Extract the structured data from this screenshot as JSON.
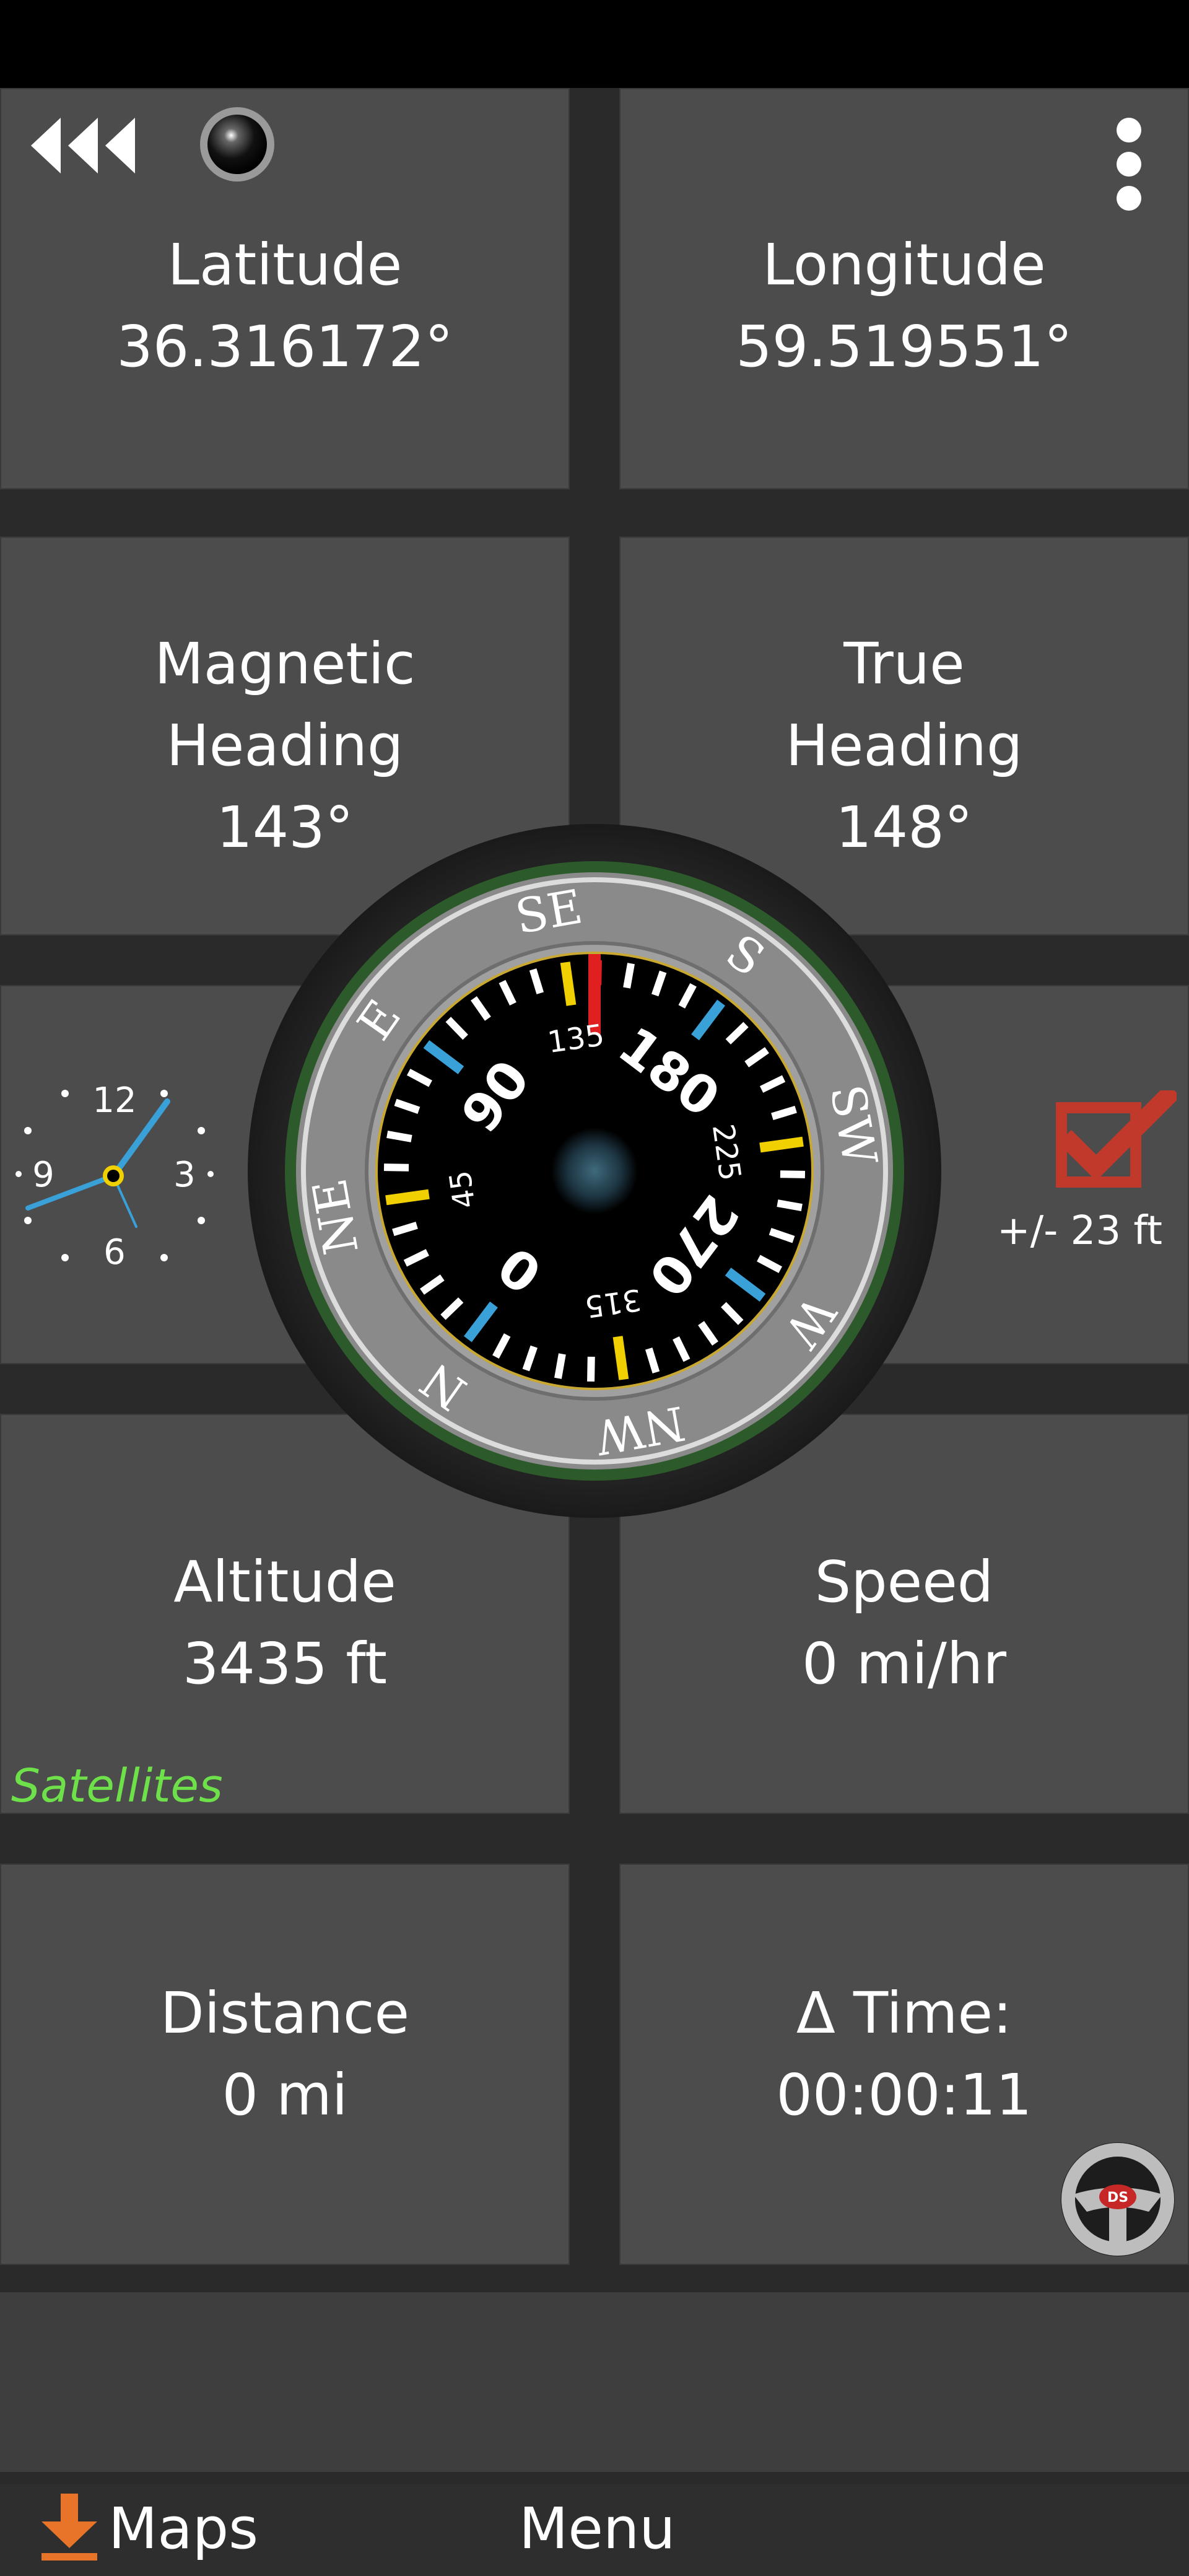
{
  "tiles": {
    "latitude": {
      "label": "Latitude",
      "value": "36.316172°"
    },
    "longitude": {
      "label": "Longitude",
      "value": "59.519551°"
    },
    "magnetic_heading": {
      "label1": "Magnetic",
      "label2": "Heading",
      "value": "143°"
    },
    "true_heading": {
      "label1": "True",
      "label2": "Heading",
      "value": "148°"
    },
    "altitude": {
      "label": "Altitude",
      "value": "3435 ft"
    },
    "speed": {
      "label": "Speed",
      "value": "0 mi/hr"
    },
    "distance": {
      "label": "Distance",
      "value": "0 mi"
    },
    "delta_time": {
      "label": "Δ Time:",
      "value": "00:00:11"
    }
  },
  "status": {
    "satellites": "Satellites",
    "accuracy": "+/- 23 ft"
  },
  "compass": {
    "heading_deg": 143,
    "ring_labels": [
      "SE",
      "S",
      "SW",
      "W",
      "NW",
      "N",
      "NE",
      "E"
    ],
    "dial_labels": [
      "135",
      "180",
      "225",
      "270",
      "315",
      "0",
      "45",
      "90"
    ],
    "colors": {
      "blue": "#3aa0d8",
      "yellow": "#f0d000",
      "red": "#e02020",
      "green_rim": "#2d5a2a"
    }
  },
  "clock": {
    "labels": [
      "12",
      "3",
      "6",
      "9"
    ]
  },
  "bottom": {
    "maps_label": "Maps",
    "menu_label": "Menu"
  },
  "icons": {
    "back": "triple-chevron-left-icon",
    "record": "record-ball-icon",
    "more": "vertical-dots-icon",
    "checkbox": "checked-checkbox-icon",
    "steering": "steering-wheel-icon",
    "steering_badge": "DS",
    "download": "download-arrow-icon"
  },
  "accent_color": "#e8742a",
  "checkbox_color": "#c0392b"
}
